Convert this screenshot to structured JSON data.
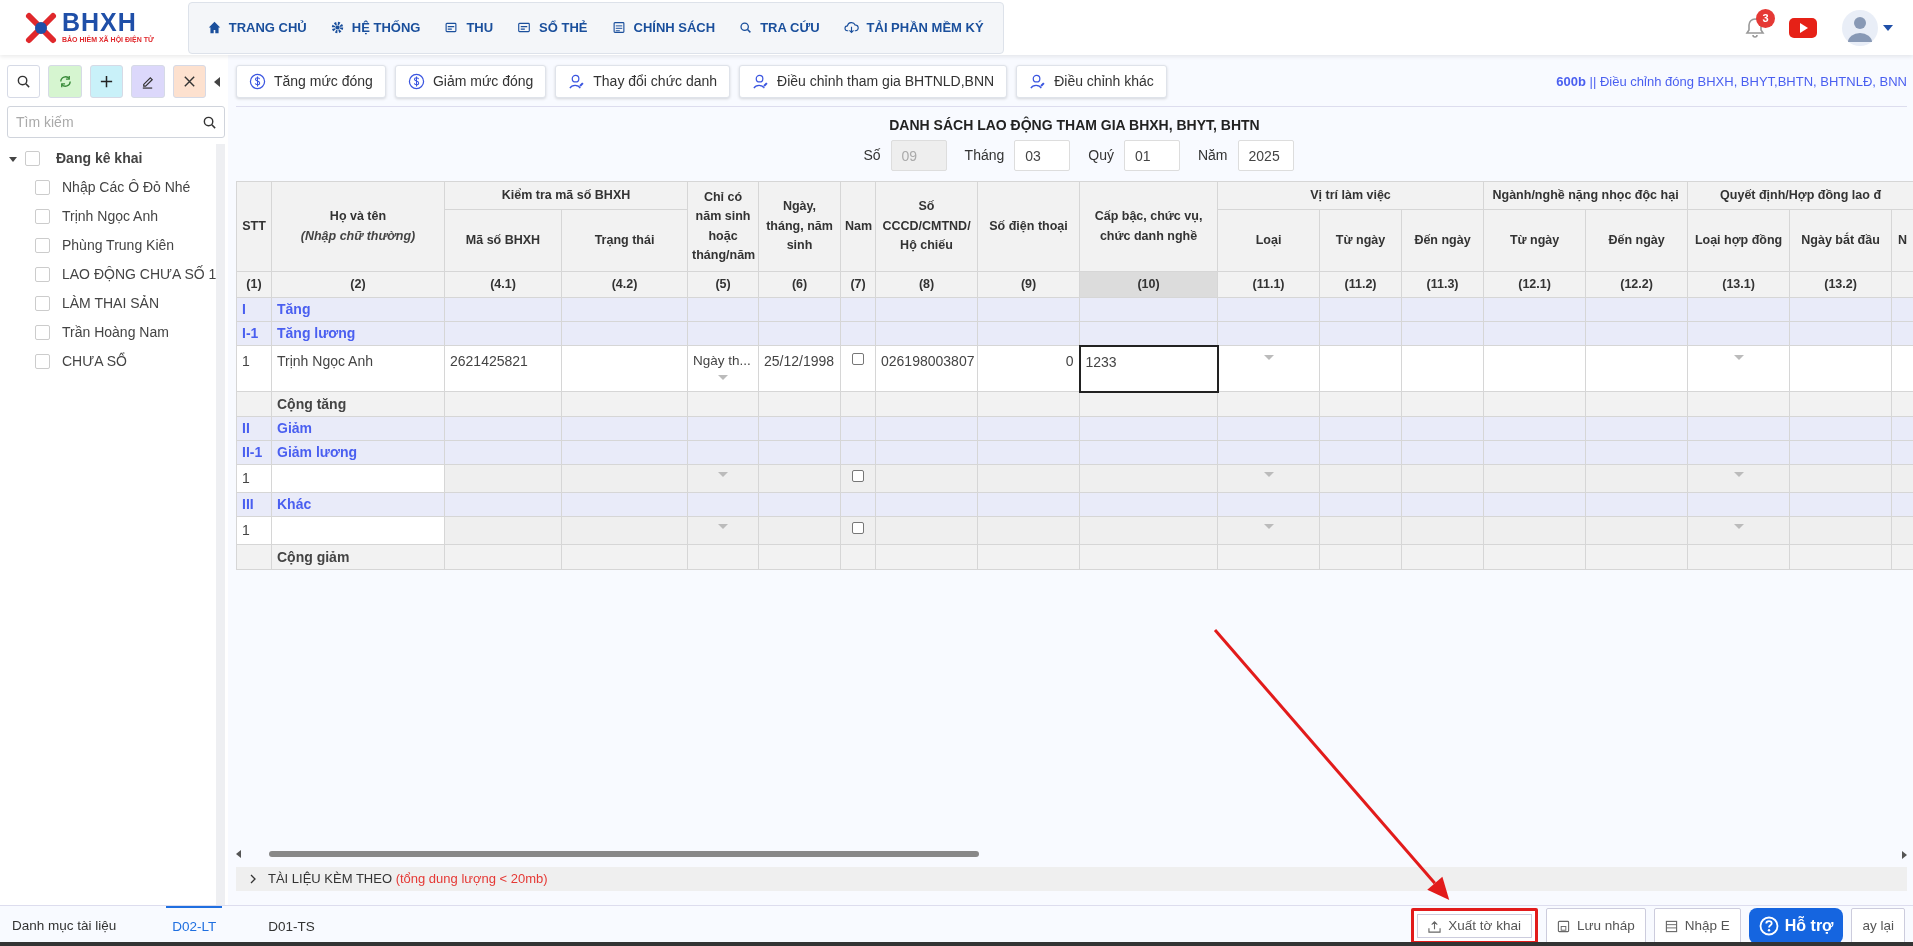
{
  "header": {
    "logo": {
      "title": "BHXH",
      "subtitle": "BẢO HIỂM XÃ HỘI ĐIỆN TỬ"
    },
    "nav": [
      {
        "label": "TRANG CHỦ"
      },
      {
        "label": "HỆ THỐNG"
      },
      {
        "label": "THU"
      },
      {
        "label": "SỔ THẺ"
      },
      {
        "label": "CHÍNH SÁCH"
      },
      {
        "label": "TRA CỨU"
      },
      {
        "label": "TẢI PHẦN MỀM KÝ"
      }
    ],
    "notification_count": "3"
  },
  "sidebar": {
    "search": {
      "placeholder": "Tìm kiếm"
    },
    "tree": {
      "label": "Đang kê khai",
      "expanded": true,
      "checked": false,
      "children": [
        {
          "label": "Nhập Các Ô Đỏ Nhé",
          "checked": false
        },
        {
          "label": "Trịnh Ngọc Anh",
          "checked": false
        },
        {
          "label": "Phùng Trung Kiên",
          "checked": false
        },
        {
          "label": "LAO ĐỘNG CHƯA SỐ 1",
          "checked": false
        },
        {
          "label": "LÀM THAI SẢN",
          "checked": false
        },
        {
          "label": "Trần Hoàng Nam",
          "checked": false
        },
        {
          "label": "CHƯA SỔ",
          "checked": false
        }
      ]
    }
  },
  "actions": [
    {
      "label": "Tăng mức đóng"
    },
    {
      "label": "Giảm mức đóng"
    },
    {
      "label": "Thay đổi chức danh"
    },
    {
      "label": "Điều chỉnh tham gia BHTNLD,BNN"
    },
    {
      "label": "Điều chỉnh khác"
    }
  ],
  "form": {
    "code": "600b",
    "separator": "||",
    "name": "Điều chỉnh đóng BHXH, BHYT,BHTN, BHTNLĐ, BNN"
  },
  "title": "DANH SÁCH LAO ĐỘNG THAM GIA BHXH, BHYT, BHTN",
  "fields": [
    {
      "label": "Số",
      "value": "09",
      "disabled": true
    },
    {
      "label": "Tháng",
      "value": "03",
      "disabled": false
    },
    {
      "label": "Quý",
      "value": "01",
      "disabled": false
    },
    {
      "label": "Năm",
      "value": "2025",
      "disabled": false
    }
  ],
  "table": {
    "columns": [
      {
        "heading": "STT",
        "number": "(1)",
        "selected": false
      },
      {
        "heading": "Họ và tên",
        "note": "(Nhập chữ thường)",
        "number": "(2)",
        "selected": false
      },
      {
        "group": "Kiểm tra mã số BHXH",
        "columns": [
          {
            "heading": "Mã số BHXH",
            "number": "(4.1)",
            "selected": false
          },
          {
            "heading": "Trạng thái",
            "number": "(4.2)",
            "selected": false
          }
        ]
      },
      {
        "heading": "Chỉ có năm sinh hoặc tháng/năm",
        "number": "(5)",
        "selected": false
      },
      {
        "heading": "Ngày, tháng, năm sinh",
        "number": "(6)",
        "selected": false
      },
      {
        "heading": "Nam",
        "number": "(7)",
        "selected": false
      },
      {
        "heading": "Số CCCD/CMTND/ Hộ chiếu",
        "number": "(8)",
        "selected": false
      },
      {
        "heading": "Số điện thoại",
        "number": "(9)",
        "selected": false
      },
      {
        "heading": "Cấp bậc, chức vụ, chức danh nghề",
        "number": "(10)",
        "selected": true
      },
      {
        "group": "Vị trí làm việc",
        "columns": [
          {
            "heading": "Loại",
            "number": "(11.1)",
            "selected": false
          },
          {
            "heading": "Từ ngày",
            "number": "(11.2)",
            "selected": false
          },
          {
            "heading": "Đến ngày",
            "number": "(11.3)",
            "selected": false
          }
        ]
      },
      {
        "group": "Ngành/nghề nặng nhọc độc hại",
        "columns": [
          {
            "heading": "Từ ngày",
            "number": "(12.1)",
            "selected": false
          },
          {
            "heading": "Đến ngày",
            "number": "(12.2)",
            "selected": false
          }
        ]
      },
      {
        "group": "Quyết định/Hợp đồng lao đ",
        "columns": [
          {
            "heading": "Loại hợp đồng",
            "number": "(13.1)",
            "selected": false
          },
          {
            "heading": "Ngày bắt đầu",
            "number": "(13.2)",
            "selected": false
          },
          {
            "heading": "N",
            "selected": false
          }
        ]
      }
    ],
    "rows": [
      {
        "kind": "section",
        "stt": "I",
        "label": "Tăng"
      },
      {
        "kind": "section",
        "stt": "I-1",
        "label": "Tăng lương"
      },
      {
        "kind": "data",
        "disabled": false,
        "cells": [
          {
            "kind": "text",
            "value": "1",
            "selected": false
          },
          {
            "kind": "text",
            "value": "Trịnh Ngọc Anh",
            "selected": false
          },
          {
            "kind": "text",
            "value": "2621425821",
            "selected": false
          },
          {
            "kind": "empty",
            "selected": false
          },
          {
            "kind": "dropdown",
            "value": "Ngày th...",
            "selected": false
          },
          {
            "kind": "text",
            "value": "25/12/1998",
            "selected": false
          },
          {
            "kind": "checkbox",
            "checked": false,
            "selected": false
          },
          {
            "kind": "text",
            "value": "026198003807",
            "selected": false
          },
          {
            "kind": "number",
            "value": "0",
            "selected": false
          },
          {
            "kind": "text",
            "value": "1233",
            "selected": true
          },
          {
            "kind": "dropdown",
            "selected": false
          },
          {
            "kind": "empty",
            "selected": false
          },
          {
            "kind": "empty",
            "selected": false
          },
          {
            "kind": "empty",
            "selected": false
          },
          {
            "kind": "empty",
            "selected": false
          },
          {
            "kind": "dropdown",
            "selected": false
          },
          {
            "kind": "empty",
            "selected": false
          },
          {
            "kind": "empty",
            "selected": false
          }
        ]
      },
      {
        "kind": "total",
        "label": "Cộng tăng"
      },
      {
        "kind": "section",
        "stt": "II",
        "label": "Giảm"
      },
      {
        "kind": "section",
        "stt": "II-1",
        "label": "Giảm lương"
      },
      {
        "kind": "data",
        "disabled": true,
        "cells": [
          {
            "kind": "text",
            "value": "1",
            "selected": false
          },
          {
            "kind": "empty",
            "selected": false
          },
          {
            "kind": "empty",
            "selected": false
          },
          {
            "kind": "empty",
            "selected": false
          },
          {
            "kind": "dropdown",
            "selected": false
          },
          {
            "kind": "empty",
            "selected": false
          },
          {
            "kind": "checkbox",
            "checked": false,
            "selected": false
          },
          {
            "kind": "empty",
            "selected": false
          },
          {
            "kind": "empty",
            "selected": false
          },
          {
            "kind": "empty",
            "selected": false
          },
          {
            "kind": "dropdown",
            "selected": false
          },
          {
            "kind": "empty",
            "selected": false
          },
          {
            "kind": "empty",
            "selected": false
          },
          {
            "kind": "empty",
            "selected": false
          },
          {
            "kind": "empty",
            "selected": false
          },
          {
            "kind": "dropdown",
            "selected": false
          },
          {
            "kind": "empty",
            "selected": false
          },
          {
            "kind": "empty",
            "selected": false
          }
        ]
      },
      {
        "kind": "section",
        "stt": "III",
        "label": "Khác"
      },
      {
        "kind": "data",
        "disabled": true,
        "cells": [
          {
            "kind": "text",
            "value": "1",
            "selected": false
          },
          {
            "kind": "empty",
            "selected": false
          },
          {
            "kind": "empty",
            "selected": false
          },
          {
            "kind": "empty",
            "selected": false
          },
          {
            "kind": "dropdown",
            "selected": false
          },
          {
            "kind": "empty",
            "selected": false
          },
          {
            "kind": "checkbox",
            "checked": false,
            "selected": false
          },
          {
            "kind": "empty",
            "selected": false
          },
          {
            "kind": "empty",
            "selected": false
          },
          {
            "kind": "empty",
            "selected": false
          },
          {
            "kind": "dropdown",
            "selected": false
          },
          {
            "kind": "empty",
            "selected": false
          },
          {
            "kind": "empty",
            "selected": false
          },
          {
            "kind": "empty",
            "selected": false
          },
          {
            "kind": "empty",
            "selected": false
          },
          {
            "kind": "dropdown",
            "selected": false
          },
          {
            "kind": "empty",
            "selected": false
          },
          {
            "kind": "empty",
            "selected": false
          }
        ]
      },
      {
        "kind": "total",
        "label": "Cộng giảm"
      }
    ]
  },
  "attachments": {
    "label": "TÀI LIỆU KÈM THEO",
    "note": "(tổng dung lượng < 20mb)",
    "expanded": false
  },
  "bottom": {
    "label": "Danh mục tài liệu",
    "tabs": [
      {
        "label": "D02-LT",
        "selected": true
      },
      {
        "label": "D01-TS",
        "selected": false
      }
    ],
    "buttons": [
      {
        "label": "Xuất tờ khai",
        "highlighted": true
      },
      {
        "label": "Lưu nháp",
        "highlighted": false
      },
      {
        "label": "Nhập E",
        "highlighted": false
      },
      {
        "label": "ay lại",
        "highlighted": false
      }
    ],
    "help": {
      "label": "Hỗ trợ"
    }
  }
}
